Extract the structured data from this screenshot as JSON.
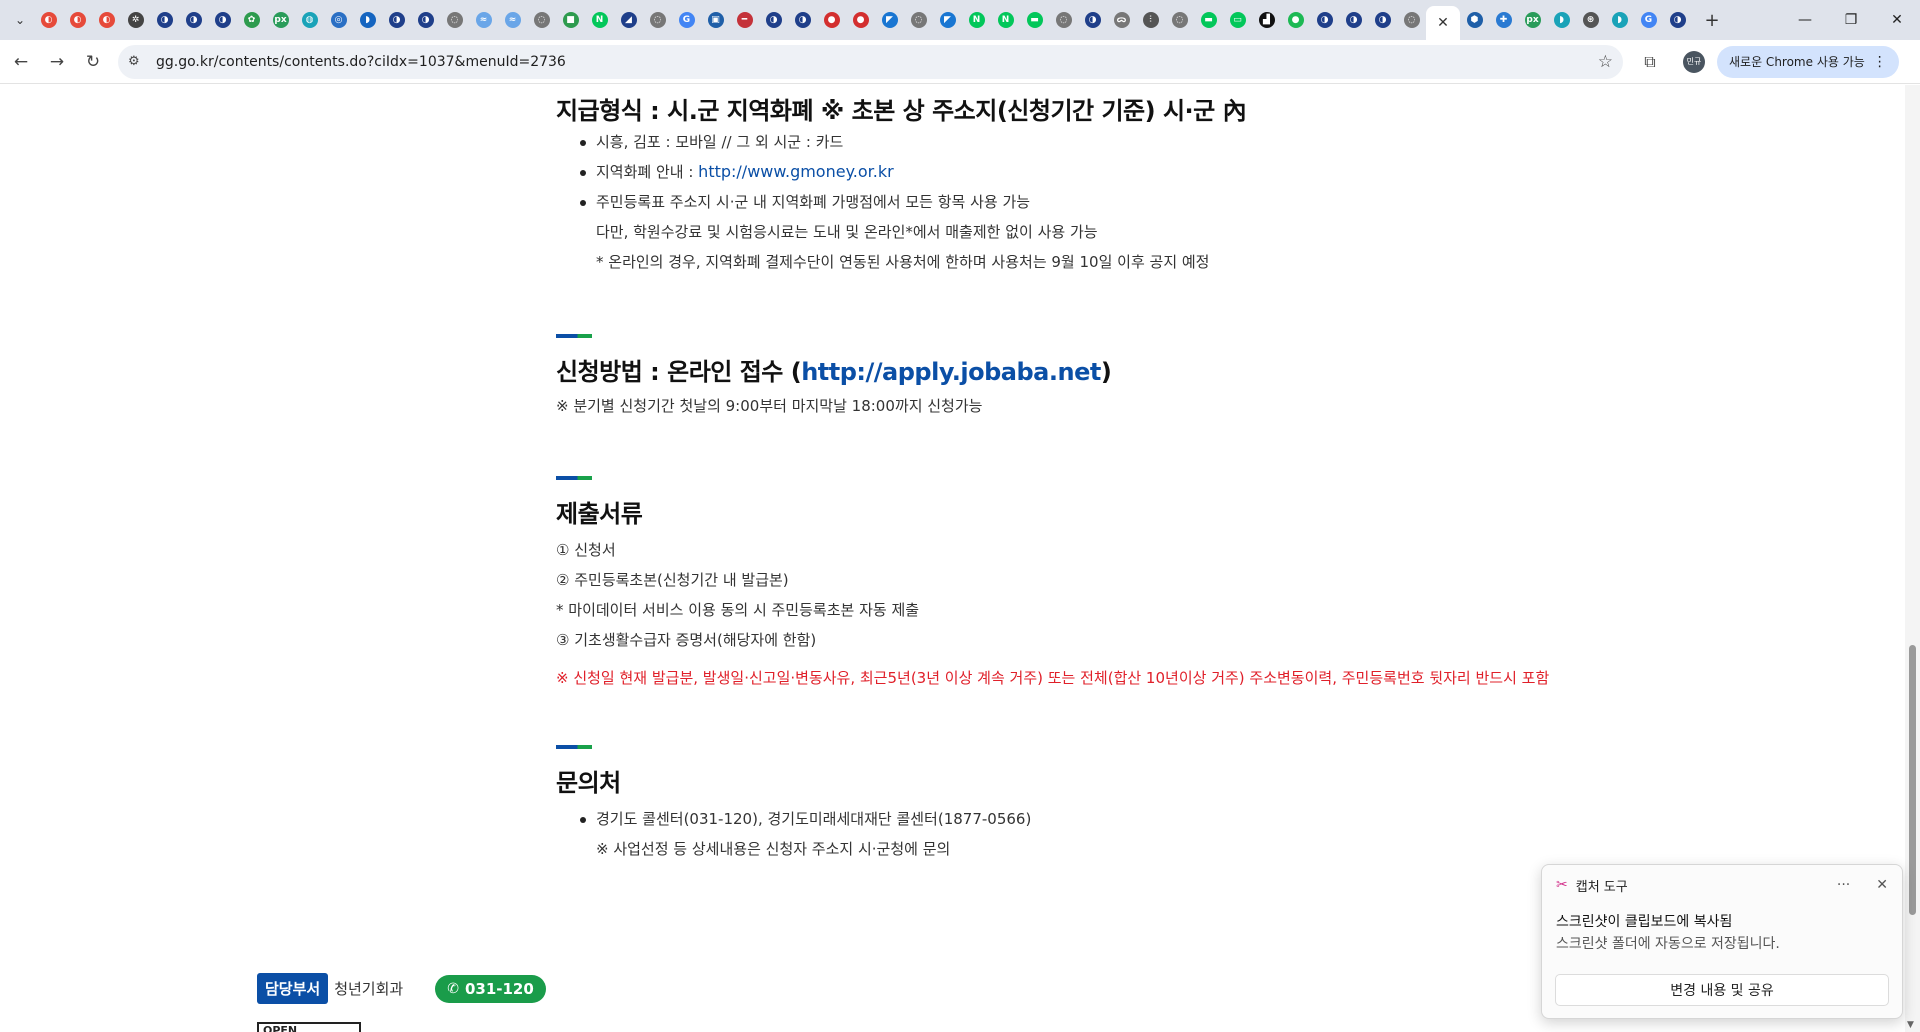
{
  "browser": {
    "tabs": [
      {
        "icon": "flag-icon",
        "color": "#e64a3a",
        "glyph": "◐"
      },
      {
        "icon": "flag-icon",
        "color": "#e64a3a",
        "glyph": "◐"
      },
      {
        "icon": "flag-icon",
        "color": "#e64a3a",
        "glyph": "◐"
      },
      {
        "icon": "gear-icon",
        "color": "#444444",
        "glyph": "✲"
      },
      {
        "icon": "gov-icon",
        "color": "#1f3f8a",
        "glyph": "◑"
      },
      {
        "icon": "gov-icon",
        "color": "#1f3f8a",
        "glyph": "◑"
      },
      {
        "icon": "gov-icon",
        "color": "#1f3f8a",
        "glyph": "◑"
      },
      {
        "icon": "leaf-icon",
        "color": "#2e9b4e",
        "glyph": "✿"
      },
      {
        "icon": "px-icon",
        "color": "#2a9c5a",
        "glyph": "px"
      },
      {
        "icon": "site-icon",
        "color": "#1aa3b8",
        "glyph": "◍"
      },
      {
        "icon": "site-icon",
        "color": "#2a6fc4",
        "glyph": "◎"
      },
      {
        "icon": "site-icon",
        "color": "#1565c0",
        "glyph": "◗"
      },
      {
        "icon": "gov-icon",
        "color": "#1f3f8a",
        "glyph": "◑"
      },
      {
        "icon": "gov-icon",
        "color": "#1f3f8a",
        "glyph": "◑"
      },
      {
        "icon": "globe-icon",
        "color": "#777777",
        "glyph": "◌"
      },
      {
        "icon": "site-icon",
        "color": "#6aa6e8",
        "glyph": "≈"
      },
      {
        "icon": "site-icon",
        "color": "#6aa6e8",
        "glyph": "≈"
      },
      {
        "icon": "globe-icon",
        "color": "#777777",
        "glyph": "◌"
      },
      {
        "icon": "site-icon",
        "color": "#2e9b4e",
        "glyph": "■"
      },
      {
        "icon": "naver-icon",
        "color": "#03c75a",
        "glyph": "N"
      },
      {
        "icon": "site-icon",
        "color": "#1f3f8a",
        "glyph": "◢"
      },
      {
        "icon": "globe-icon",
        "color": "#777777",
        "glyph": "◌"
      },
      {
        "icon": "google-icon",
        "color": "#4285f4",
        "glyph": "G"
      },
      {
        "icon": "site-icon",
        "color": "#1f5fa8",
        "glyph": "▣"
      },
      {
        "icon": "site-icon",
        "color": "#c4323a",
        "glyph": "━"
      },
      {
        "icon": "gov-icon",
        "color": "#1f3f8a",
        "glyph": "◑"
      },
      {
        "icon": "gov-icon",
        "color": "#1f3f8a",
        "glyph": "◑"
      },
      {
        "icon": "site-icon",
        "color": "#d32f2f",
        "glyph": "●"
      },
      {
        "icon": "site-icon",
        "color": "#d32f2f",
        "glyph": "●"
      },
      {
        "icon": "site-icon",
        "color": "#1976d2",
        "glyph": "◤"
      },
      {
        "icon": "globe-icon",
        "color": "#777777",
        "glyph": "◌"
      },
      {
        "icon": "site-icon",
        "color": "#1976d2",
        "glyph": "◤"
      },
      {
        "icon": "naver-icon",
        "color": "#03c75a",
        "glyph": "N"
      },
      {
        "icon": "naver-icon",
        "color": "#03c75a",
        "glyph": "N"
      },
      {
        "icon": "site-icon",
        "color": "#03c75a",
        "glyph": "▬"
      },
      {
        "icon": "globe-icon",
        "color": "#777777",
        "glyph": "◌"
      },
      {
        "icon": "gov-icon",
        "color": "#1f3f8a",
        "glyph": "◑"
      },
      {
        "icon": "site-icon",
        "color": "#777777",
        "glyph": "ᯅ"
      },
      {
        "icon": "site-icon",
        "color": "#555555",
        "glyph": "⫶"
      },
      {
        "icon": "globe-icon",
        "color": "#777777",
        "glyph": "◌"
      },
      {
        "icon": "site-icon",
        "color": "#03c75a",
        "glyph": "▬"
      },
      {
        "icon": "site-icon",
        "color": "#03c75a",
        "glyph": "▭"
      },
      {
        "icon": "site-icon",
        "color": "#111111",
        "glyph": "▟"
      },
      {
        "icon": "site-icon",
        "color": "#1db954",
        "glyph": "●"
      },
      {
        "icon": "gov-icon",
        "color": "#1f3f8a",
        "glyph": "◑"
      },
      {
        "icon": "gov-icon",
        "color": "#1f3f8a",
        "glyph": "◑"
      },
      {
        "icon": "gov-icon",
        "color": "#1f3f8a",
        "glyph": "◑"
      },
      {
        "icon": "globe-icon",
        "color": "#777777",
        "glyph": "◌"
      }
    ],
    "tabs_after": [
      {
        "icon": "site-icon",
        "color": "#1f5fa8",
        "glyph": "⬢"
      },
      {
        "icon": "site-icon",
        "color": "#2a7ad2",
        "glyph": "✚"
      },
      {
        "icon": "px-icon",
        "color": "#2a9c5a",
        "glyph": "px"
      },
      {
        "icon": "site-icon",
        "color": "#1aa3b8",
        "glyph": "◗"
      },
      {
        "icon": "site-icon",
        "color": "#555555",
        "glyph": "⊛"
      },
      {
        "icon": "site-icon",
        "color": "#1aa3b8",
        "glyph": "◗"
      },
      {
        "icon": "google-icon",
        "color": "#4285f4",
        "glyph": "G"
      },
      {
        "icon": "gov-icon",
        "color": "#1f3f8a",
        "glyph": "◑"
      }
    ],
    "url": "gg.go.kr/contents/contents.do?ciIdx=1037&menuId=2736",
    "profile_label": "민규",
    "chrome_pill_label": "새로운 Chrome 사용 가능"
  },
  "page": {
    "payment": {
      "heading": "지급형식 : 시.군 지역화폐 ※ 초본 상 주소지(신청기간 기준) 시·군 內",
      "items": [
        "시흥, 김포 : 모바일 // 그 외 시군 : 카드",
        "지역화폐 안내 : ",
        "주민등록표 주소지 시·군 내 지역화폐 가맹점에서 모든 항목 사용 가능"
      ],
      "link": "http://www.gmoney.or.kr",
      "sub_lines": [
        "다만, 학원수강료 및 시험응시료는 도내 및 온라인*에서 매출제한 없이 사용 가능",
        "* 온라인의 경우, 지역화폐 결제수단이 연동된 사용처에 한하며 사용처는 9월 10일 이후 공지 예정"
      ]
    },
    "apply": {
      "heading_prefix": "신청방법 : 온라인 접수 (",
      "heading_link": "http://apply.jobaba.net",
      "heading_suffix": ")",
      "note": "※ 분기별 신청기간 첫날의 9:00부터 마지막날 18:00까지 신청가능"
    },
    "documents": {
      "heading": "제출서류",
      "lines": [
        "① 신청서",
        "② 주민등록초본(신청기간 내 발급본)",
        "* 마이데이터 서비스 이용 동의 시 주민등록초본 자동 제출",
        "③ 기초생활수급자 증명서(해당자에 한함)"
      ],
      "warning": "※ 신청일 현재 발급분, 발생일·신고일·변동사유, 최근5년(3년 이상 계속 거주) 또는 전체(합산 10년이상 거주) 주소변동이력, 주민등록번호 뒷자리 반드시 포함"
    },
    "contact": {
      "heading": "문의처",
      "item": "경기도 콜센터(031-120), 경기도미래세대재단 콜센터(1877-0566)",
      "sub": "※ 사업선정 등 상세내용은 신청자 주소지 시·군청에 문의"
    },
    "footer": {
      "dept_badge": "담당부서",
      "dept_name": "청년기회과",
      "phone": "031-120",
      "open_label": "OPEN"
    }
  },
  "toast": {
    "app_name": "캡처 도구",
    "title": "스크린샷이 클립보드에 복사됨",
    "message": "스크린샷 폴더에 자동으로 저장됩니다.",
    "button": "변경 내용 및 공유"
  },
  "colors": {
    "accent_blue": "#0b4fa6",
    "accent_green": "#1a9c4a",
    "warning_red": "#e0202a"
  }
}
